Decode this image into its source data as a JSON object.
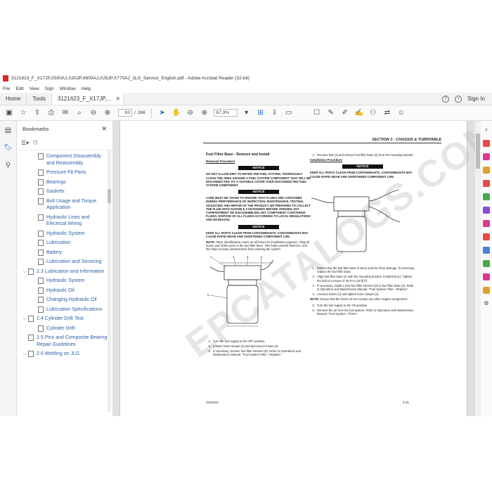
{
  "window": {
    "title": "3121623_F_X17JP,X500AJ,X20JP,X600AJ,X26JP,X770AJ_JLG_Service_English.pdf - Adobe Acrobat Reader (32-bit)"
  },
  "menu": [
    "File",
    "Edit",
    "View",
    "Sign",
    "Window",
    "Help"
  ],
  "tabs": {
    "home": "Home",
    "tools": "Tools",
    "doc": "3121623_F_X17JP,...",
    "sign_in": "Sign In"
  },
  "toolbar": {
    "page_current": "63",
    "page_sep": "/",
    "page_total": "268",
    "zoom": "67,9%"
  },
  "bookmarks": {
    "title": "Bookmarks",
    "items": [
      {
        "label": "Component Disassembly and Reassembly",
        "level": 2,
        "chevron": ""
      },
      {
        "label": "Pressure-Fit Parts",
        "level": 2,
        "chevron": ""
      },
      {
        "label": "Bearings",
        "level": 2,
        "chevron": ""
      },
      {
        "label": "Gaskets",
        "level": 2,
        "chevron": ""
      },
      {
        "label": "Bolt Usage and Torque Application",
        "level": 2,
        "chevron": ""
      },
      {
        "label": "Hydraulic Lines and Electrical Wiring",
        "level": 2,
        "chevron": ""
      },
      {
        "label": "Hydraulic System",
        "level": 2,
        "chevron": ""
      },
      {
        "label": "Lubrication",
        "level": 2,
        "chevron": ""
      },
      {
        "label": "Battery",
        "level": 2,
        "chevron": ""
      },
      {
        "label": "Lubrication and Servicing",
        "level": 2,
        "chevron": ""
      },
      {
        "label": "2.3 Lubrication and Information",
        "level": 1,
        "chevron": "v"
      },
      {
        "label": "Hydraulic System",
        "level": 2,
        "chevron": ""
      },
      {
        "label": "Hydraulic Oil",
        "level": 2,
        "chevron": ""
      },
      {
        "label": "Changing Hydraulic Oil",
        "level": 2,
        "chevron": ""
      },
      {
        "label": "Lubrication Specifications",
        "level": 2,
        "chevron": ""
      },
      {
        "label": "2.4 Cylinder Drift Test",
        "level": 1,
        "chevron": "v"
      },
      {
        "label": "Cylinder Drift",
        "level": 2,
        "chevron": ""
      },
      {
        "label": "2.5 Pins and Composite Bearing Repair Guidelines",
        "level": 1,
        "chevron": ""
      },
      {
        "label": "2.6 Welding on JLG",
        "level": 1,
        "chevron": "v"
      }
    ]
  },
  "page": {
    "header": "SECTION 3 - CHASSIS & TURNTABLE",
    "watermark": "EPCATALOGS.COM",
    "left": {
      "title": "Fuel Filter Base - Remove and Install",
      "subtitle": "Removal Procedure",
      "notice": "NOTICE",
      "notice1": "DO NOT ALLOW DIRT TO ENTER THE FUEL SYSTEM. THOROUGHLY CLEAN THE AREA AROUND A FUEL SYSTEM COMPONENT THAT WILL BE DISCONNECTED. FIT A SUITABLE COVER OVER DISCONNECTED FUEL SYSTEM COMPONENT.",
      "notice2": "CARE MUST BE TAKEN TO ENSURE THAT FLUIDS ARE CONTAINED DURING PERFORMANCE OF INSPECTION, MAINTENANCE, TESTING, ADJUSTING AND REPAIR OF THE PRODUCT. BE PREPARED TO COLLECT THE FLUID WITH SUITABLE CONTAINERS BEFORE OPENING ANY COMPARTMENT OR DISASSEMBLING ANY COMPONENT CONTAINING FLUIDS. DISPOSE OF ALL FLUIDS ACCORDING TO LOCAL REGULATIONS AND MANDATES.",
      "notice3": "KEEP ALL PARTS CLEAN FROM CONTAMINANTS. CONTAMINANTS MAY CAUSE RAPID WEAR AND SHORTENED COMPONENT LIFE.",
      "note_label": "NOTE:",
      "note": "Place identification marks on all hoses for installation purposes. Plug all hoses and all the ports in the fuel filter base. This helps prevent fluid loss, and this helps to keep contaminants from entering the system.",
      "steps": [
        "Turn the fuel supply to the OFF position.",
        "Loosen hose clamps (3) and disconnect hoses (4).",
        "If necessary, remove fuel filter element (5). Refer to Operations and Maintenance Manual, \"Fuel System Filter - Replace\"."
      ],
      "callouts": [
        "1",
        "2",
        "3",
        "4",
        "5"
      ]
    },
    "right": {
      "step4": "Remove bolt (1) and remove fuel filter base (2) from the mounting bracket.",
      "subtitle": "Installation Procedure",
      "notice": "NOTICE",
      "notice1": "KEEP ALL PARTS CLEAN FROM CONTAMINANTS. CONTAMINANTS MAY CAUSE RAPID WEAR AND SHORTENED COMPONENT LIFE.",
      "steps": [
        "Ensure that the fuel filter base is clean and free from damage. If necessary, replace the fuel filter base.",
        "Align fuel filter base (2) with the mounting bracket. Install bolt (1). Tighten the bolt to a torque of 25 N·m (18 lb ft).",
        "If necessary, install a new fuel filter element (5) to fuel filter base (2). Refer to Operation and Maintenance Manual, \"Fuel System Filter - Replace\".",
        "Connect hoses (4) and tighten hose clamps (3)."
      ],
      "note_label": "NOTE:",
      "note": "Ensure that the hoses do not contact any other engine components.",
      "steps2": [
        "Turn the fuel supply to the ON position.",
        "Remove the air from the fuel system. Refer to Operation and Maintenance Manual, \"Fuel System - Prime\"."
      ]
    },
    "footer_left": "3121623",
    "footer_right": "3-31"
  },
  "colors": {
    "accent": "#1a6fd4",
    "acrobat_red": "#d92b2b"
  }
}
